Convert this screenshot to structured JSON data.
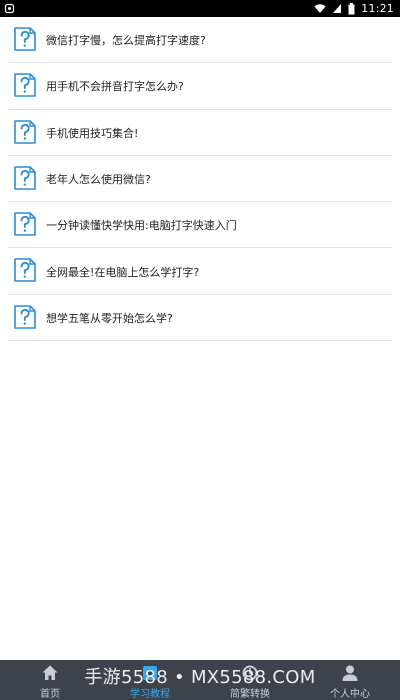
{
  "status_bar": {
    "time": "11:21"
  },
  "list": {
    "items": [
      {
        "title": "微信打字慢，怎么提高打字速度?",
        "icon": "question-doc-icon"
      },
      {
        "title": "用手机不会拼音打字怎么办?",
        "icon": "question-doc-icon"
      },
      {
        "title": "手机使用技巧集合!",
        "icon": "question-doc-icon"
      },
      {
        "title": "老年人怎么使用微信?",
        "icon": "question-doc-icon"
      },
      {
        "title": "一分钟读懂快学快用:电脑打字快速入门",
        "icon": "question-doc-icon"
      },
      {
        "title": "全网最全!在电脑上怎么学打字?",
        "icon": "question-doc-icon"
      },
      {
        "title": "想学五笔从零开始怎么学?",
        "icon": "question-doc-icon"
      }
    ]
  },
  "tab_bar": {
    "tabs": [
      {
        "label": "首页",
        "icon": "home-icon",
        "active": false
      },
      {
        "label": "学习教程",
        "icon": "play-icon",
        "active": true
      },
      {
        "label": "简繁转换",
        "icon": "convert-icon",
        "active": false
      },
      {
        "label": "个人中心",
        "icon": "user-icon",
        "active": false
      }
    ]
  },
  "watermark": {
    "text": "手游5588 • MX5588.COM"
  },
  "colors": {
    "accent": "#3aa7e8",
    "icon_blue": "#2b8ed6",
    "tab_bar_bg": "#3e434b",
    "divider": "#e2e2e2"
  }
}
